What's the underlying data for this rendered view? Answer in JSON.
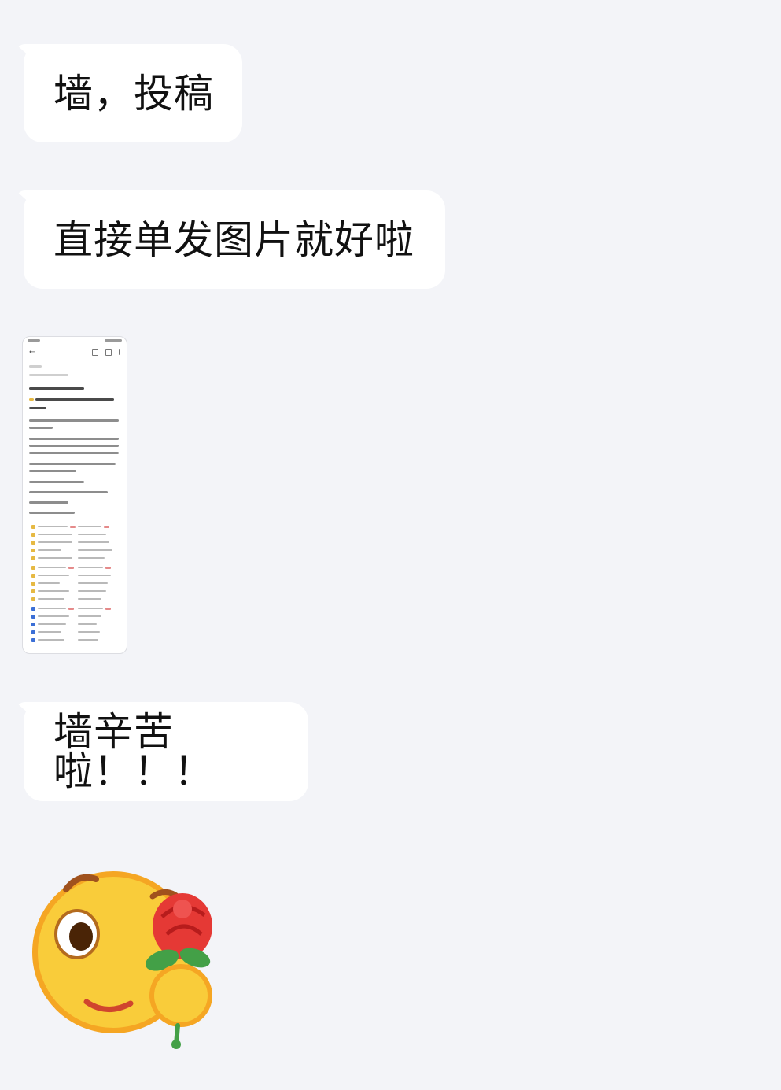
{
  "messages": [
    {
      "text": "墙，投稿"
    },
    {
      "text": "直接单发图片就好啦"
    },
    {
      "image": "phone-screenshot-thumbnail"
    },
    {
      "text": "墙辛苦啦！！！"
    },
    {
      "sticker": "smiley-holding-rose-icon"
    }
  ],
  "colors": {
    "background": "#f3f4f8",
    "bubble": "#ffffff",
    "text": "#111111",
    "emoji_face": "#f8c93a",
    "rose": "#e53935"
  }
}
